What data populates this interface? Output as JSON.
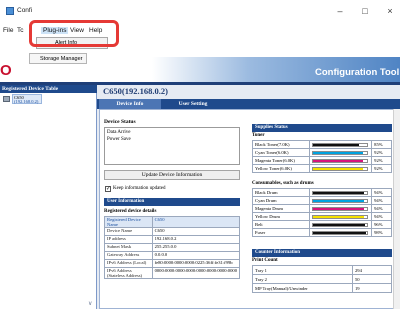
{
  "window": {
    "title": "Confi",
    "buttons": {
      "minimize": "–",
      "maximize": "□",
      "close": "×"
    }
  },
  "menubar": {
    "file": "File",
    "tools": "Tc",
    "plugins": "Plug-ins",
    "view": "View",
    "help": "Help"
  },
  "dropdown": {
    "item": "Alert Info"
  },
  "storage_menu": {
    "label": "Storage Manager"
  },
  "header": {
    "logo": "O",
    "title": "Configuration Tool"
  },
  "left_panel": {
    "title": "Registered Device Table",
    "device_line1": "C650",
    "device_line2": "(192.168.0.2)"
  },
  "device_heading": "C650(192.168.0.2)",
  "tabs": {
    "device_info": "Device Info",
    "user_setting": "User Setting"
  },
  "device_status": {
    "title": "Device Status",
    "lines": [
      "Data Arrive",
      "Power Save"
    ],
    "update_button": "Update Device Information",
    "keep_label": "Keep information updated",
    "keep_checked": true
  },
  "user_info": {
    "title": "User Information",
    "registered_title": "Registered device details",
    "rows": [
      {
        "key": "Registered Device Name",
        "value": "C650",
        "highlight": true
      },
      {
        "key": "Device Name",
        "value": "C650",
        "highlight": false
      },
      {
        "key": "IP address",
        "value": "192.168.0.2",
        "highlight": false
      },
      {
        "key": "Subnet Mask",
        "value": "255.255.0.0",
        "highlight": false
      },
      {
        "key": "Gateway Address",
        "value": "0.0.0.0",
        "highlight": false
      },
      {
        "key": "IPv6 Address (Local)",
        "value": "fe80:0000:0000:0000:0225:36ff:fe31:f99b",
        "highlight": false
      },
      {
        "key": "IPv6 Address (Stateless Address)",
        "value": "0000:0000:0000:0000:0000:0000:0000:0000",
        "highlight": false
      }
    ]
  },
  "supplies": {
    "title": "Supplies Status",
    "toner_label": "Toner",
    "toner": [
      {
        "name": "Black Toner(7.0K)",
        "percent": "85%",
        "level": 0.85,
        "color": "#111111"
      },
      {
        "name": "Cyan Toner(6.0K)",
        "percent": "92%",
        "level": 0.92,
        "color": "#00a3e0"
      },
      {
        "name": "Magenta Toner(6.0K)",
        "percent": "92%",
        "level": 0.92,
        "color": "#d6157c"
      },
      {
        "name": "Yellow Toner(6.0K)",
        "percent": "92%",
        "level": 0.92,
        "color": "#f5e000"
      }
    ],
    "consumables_label": "Consumables, such as drums",
    "consumables": [
      {
        "name": "Black Drum",
        "percent": "94%",
        "level": 0.94,
        "color": "#111111"
      },
      {
        "name": "Cyan Drum",
        "percent": "94%",
        "level": 0.94,
        "color": "#00a3e0"
      },
      {
        "name": "Magenta Drum",
        "percent": "94%",
        "level": 0.94,
        "color": "#d6157c"
      },
      {
        "name": "Yellow Drum",
        "percent": "94%",
        "level": 0.94,
        "color": "#f5e000"
      },
      {
        "name": "Belt",
        "percent": "96%",
        "level": 0.96,
        "color": "#111111"
      },
      {
        "name": "Fuser",
        "percent": "98%",
        "level": 0.98,
        "color": "#111111"
      }
    ]
  },
  "counter": {
    "title": "Counter Information",
    "print_count_label": "Print Count",
    "rows": [
      {
        "key": "Tray 1",
        "value": "294"
      },
      {
        "key": "Tray 2",
        "value": "50"
      },
      {
        "key": "MP Tray(Manual)/Unwinder",
        "value": "19"
      }
    ]
  },
  "colors": {
    "accent_navy": "#1f4a8c",
    "callout_red": "#e53935",
    "brand_red": "#c8102e"
  }
}
